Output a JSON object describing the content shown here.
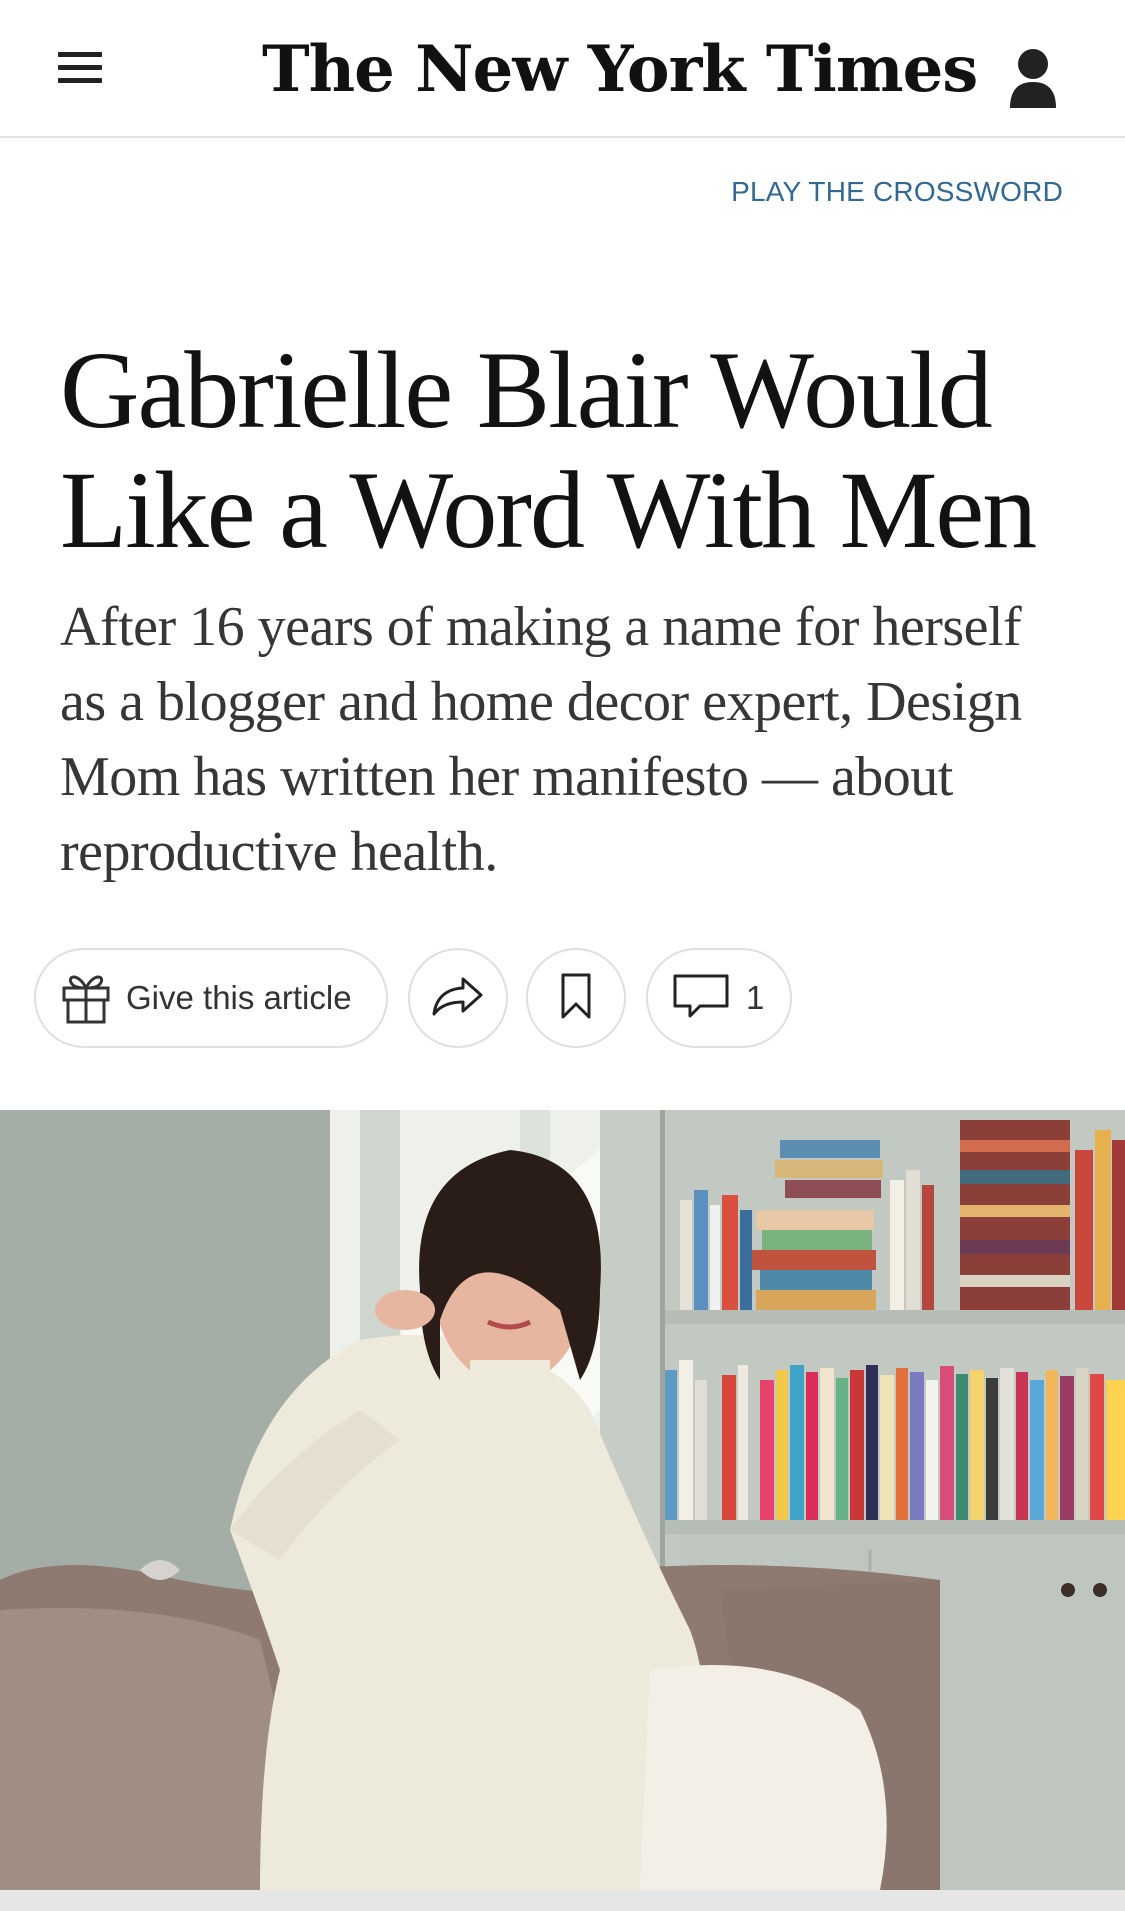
{
  "header": {
    "masthead": "The New York Times",
    "menu_icon": "hamburger-menu-icon",
    "account_icon": "account-person-icon"
  },
  "crossword_link": "PLAY THE CROSSWORD",
  "article": {
    "headline": "Gabrielle Blair Would Like a Word With Men",
    "summary": "After 16 years of making a name for herself as a blogger and home decor expert, Design Mom has written her manifesto — about reproductive health."
  },
  "toolbar": {
    "gift_label": "Give this article",
    "gift_icon": "gift-icon",
    "share_icon": "share-arrow-icon",
    "save_icon": "bookmark-icon",
    "comment_icon": "comment-bubble-icon",
    "comment_count": "1"
  },
  "colors": {
    "link_blue": "#326891",
    "text_primary": "#121212",
    "text_secondary": "#363636",
    "divider": "#e2e2e2"
  }
}
